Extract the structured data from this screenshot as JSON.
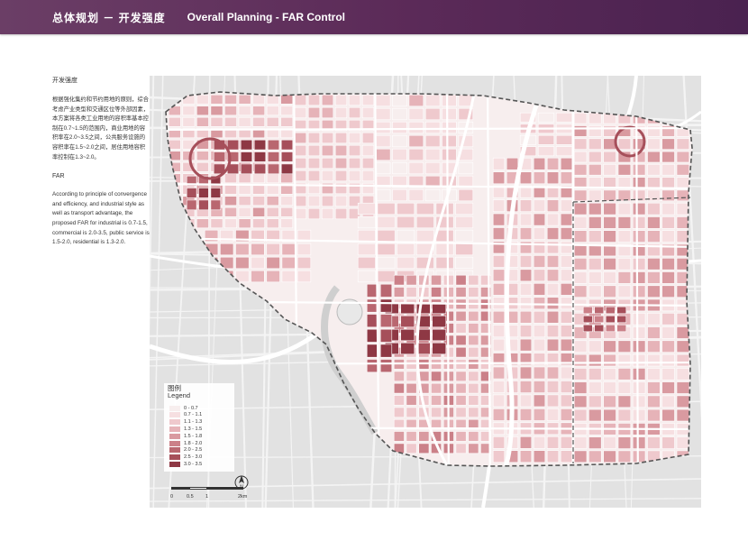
{
  "header": {
    "title_cn": "总体规划 － 开发强度",
    "title_en": "Overall Planning - FAR Control"
  },
  "sidebar": {
    "heading_cn": "开发强度",
    "text_cn": "根据强化集约和节约用地的原则，综合考虑产业类型和交通区位等外部因素，本方案将各类工业用地的容积率基本控制在0.7~1.5的范围内，商业用地的容积率在2.0~3.5之间，公共服务设施的容积率在1.5~2.0之间，居住用地容积率控制在1.3~2.0。",
    "heading_en": "FAR",
    "text_en": "According to principle of convergence and efficiency, and industrial style as well as transport advantage, the proposed FAR for industrial is 0.7-1.5, commercial is 2.0-3.5, public service is 1.5-2.0, residential is 1.3-2.0."
  },
  "legend": {
    "title_cn": "图例",
    "title_en": "Legend",
    "items": [
      {
        "label": "0 - 0.7",
        "color": "#f7eeee"
      },
      {
        "label": "0.7 - 1.1",
        "color": "#f6dfe1"
      },
      {
        "label": "1.1 - 1.3",
        "color": "#efc9cd"
      },
      {
        "label": "1.3 - 1.5",
        "color": "#e6b3b8"
      },
      {
        "label": "1.5 - 1.8",
        "color": "#d99aa0"
      },
      {
        "label": "1.8 - 2.0",
        "color": "#cb8088"
      },
      {
        "label": "2.0 - 2.5",
        "color": "#b96770"
      },
      {
        "label": "2.5 - 3.0",
        "color": "#a64f5a"
      },
      {
        "label": "3.0 - 3.5",
        "color": "#8e3844"
      }
    ]
  },
  "scalebar": {
    "ticks": [
      "0",
      "0.5",
      "1",
      "2km"
    ]
  },
  "north_arrow": {
    "label": "N"
  },
  "colors": {
    "header": "#5b2a58",
    "boundary": "#555555",
    "road": "#ffffff",
    "background": "#e2e2e2"
  }
}
